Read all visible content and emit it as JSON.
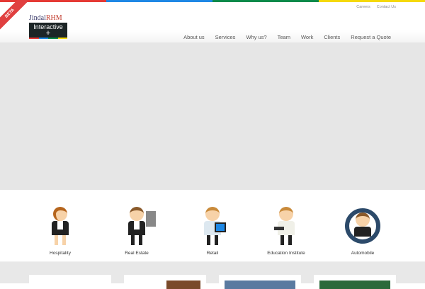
{
  "brand": {
    "name_part1": "Jindal",
    "name_part2": "RHM",
    "name_line2": "Interactive",
    "plus": "+",
    "badge": "BETA"
  },
  "colors": {
    "red": "#e53935",
    "blue": "#1e88e5",
    "green": "#0a8a4a",
    "yellow": "#f5d90a"
  },
  "top_links": [
    "Careers",
    "Contact Us"
  ],
  "nav": [
    "About us",
    "Services",
    "Why us?",
    "Team",
    "Work",
    "Clients",
    "Request a Quote"
  ],
  "industries": [
    {
      "label": "Hospitality"
    },
    {
      "label": "Real Estate"
    },
    {
      "label": "Retail"
    },
    {
      "label": "Education Institute"
    },
    {
      "label": "Automobile"
    }
  ]
}
